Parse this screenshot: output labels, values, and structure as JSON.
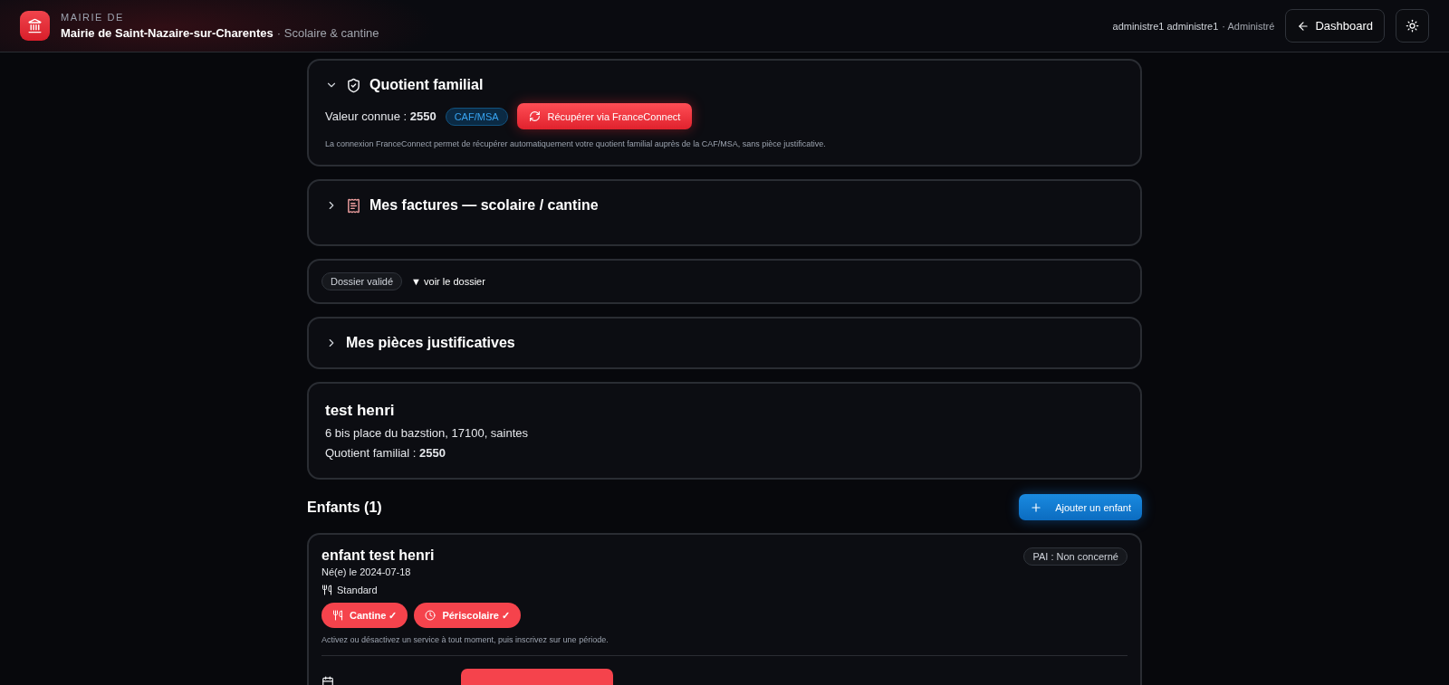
{
  "header": {
    "overline": "MAIRIE DE",
    "title": "Mairie de Saint-Nazaire-sur-Charentes",
    "subtitle": "· Scolaire & cantine",
    "user": "administre1 administre1",
    "role": "· Administré",
    "dashboard_button": "Dashboard"
  },
  "quotient": {
    "expanded": true,
    "title": "Quotient familial",
    "value_label": "Valeur connue :",
    "value": "2550",
    "source_badge": "CAF/MSA",
    "fetch_button": "Récupérer via FranceConnect",
    "note": "La connexion FranceConnect permet de récupérer automatiquement votre quotient familial auprès de la CAF/MSA, sans pièce justificative."
  },
  "invoices": {
    "expanded": false,
    "title": "Mes factures — scolaire / cantine"
  },
  "dossier": {
    "status": "Dossier validé",
    "link": "▼ voir le dossier"
  },
  "documents": {
    "expanded": false,
    "title": "Mes pièces justificatives"
  },
  "family": {
    "name": "test henri",
    "address": "6 bis place du bazstion, 17100, saintes",
    "quotient_label": "Quotient familial :",
    "quotient_value": "2550"
  },
  "children_heading": "Enfants (1)",
  "add_child_button": "Ajouter un enfant",
  "children": [
    {
      "name": "enfant test henri",
      "birth": "Né(e) le 2024-07-18",
      "pai": "PAI : Non concerné",
      "diet": "Standard",
      "services": [
        {
          "kind": "cantine",
          "label": "Cantine ✓",
          "on": true
        },
        {
          "kind": "periscolaire",
          "label": "Périscolaire ✓",
          "on": true
        }
      ],
      "hint": "Activez ou désactivez un service à tout moment, puis inscrivez sur une période."
    }
  ]
}
